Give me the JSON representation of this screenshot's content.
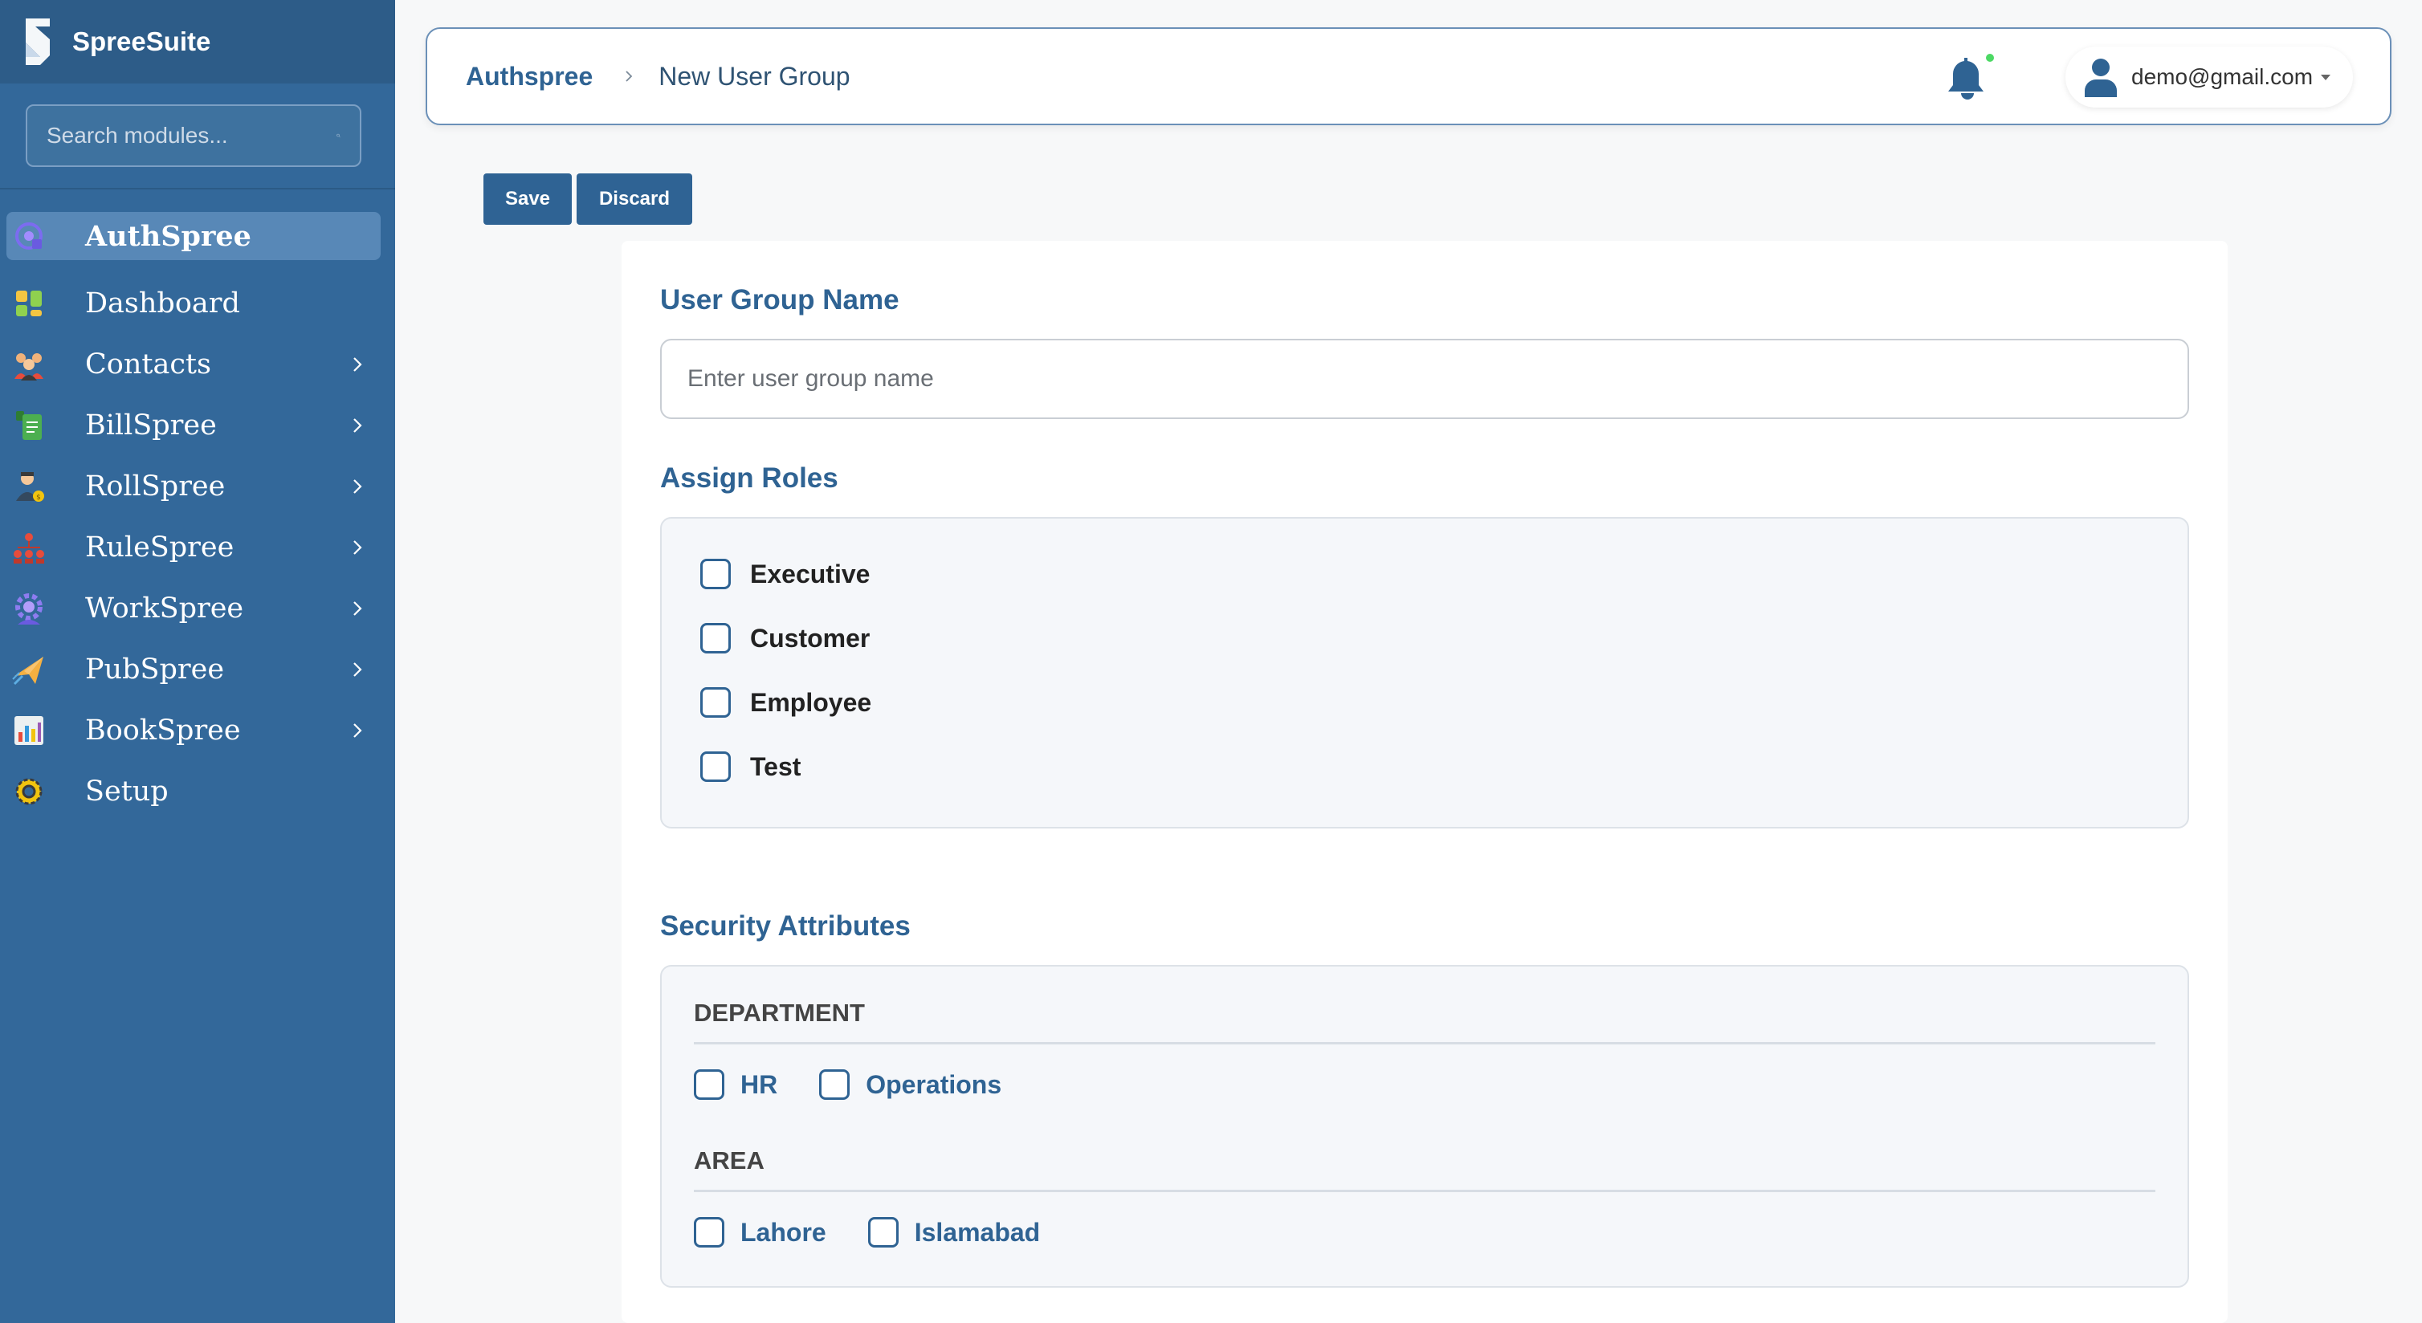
{
  "app": {
    "name": "SpreeSuite"
  },
  "search": {
    "placeholder": "Search modules..."
  },
  "sidebar": {
    "items": [
      {
        "label": "AuthSpree",
        "active": true,
        "has_children": false,
        "icon": "authspree-icon"
      },
      {
        "label": "Dashboard",
        "active": false,
        "has_children": false,
        "icon": "dashboard-icon"
      },
      {
        "label": "Contacts",
        "active": false,
        "has_children": true,
        "icon": "contacts-icon"
      },
      {
        "label": "BillSpree",
        "active": false,
        "has_children": true,
        "icon": "billspree-icon"
      },
      {
        "label": "RollSpree",
        "active": false,
        "has_children": true,
        "icon": "rollspree-icon"
      },
      {
        "label": "RuleSpree",
        "active": false,
        "has_children": true,
        "icon": "rulespree-icon"
      },
      {
        "label": "WorkSpree",
        "active": false,
        "has_children": true,
        "icon": "workspree-icon"
      },
      {
        "label": "PubSpree",
        "active": false,
        "has_children": true,
        "icon": "pubspree-icon"
      },
      {
        "label": "BookSpree",
        "active": false,
        "has_children": true,
        "icon": "bookspree-icon"
      },
      {
        "label": "Setup",
        "active": false,
        "has_children": false,
        "icon": "setup-gear-icon"
      }
    ]
  },
  "header": {
    "breadcrumb_root": "Authspree",
    "breadcrumb_current": "New User Group",
    "notification_dot_color": "#4cd964",
    "user_email": "demo@gmail.com"
  },
  "toolbar": {
    "save_label": "Save",
    "discard_label": "Discard"
  },
  "form": {
    "group_name_title": "User Group Name",
    "group_name_placeholder": "Enter user group name",
    "group_name_value": "",
    "roles_title": "Assign Roles",
    "roles": [
      {
        "label": "Executive",
        "checked": false
      },
      {
        "label": "Customer",
        "checked": false
      },
      {
        "label": "Employee",
        "checked": false
      },
      {
        "label": "Test",
        "checked": false
      }
    ],
    "security_title": "Security Attributes",
    "attributes": [
      {
        "heading": "DEPARTMENT",
        "options": [
          {
            "label": "HR",
            "checked": false
          },
          {
            "label": "Operations",
            "checked": false
          }
        ]
      },
      {
        "heading": "AREA",
        "options": [
          {
            "label": "Lahore",
            "checked": false
          },
          {
            "label": "Islamabad",
            "checked": false
          }
        ]
      }
    ]
  },
  "colors": {
    "sidebar_bg": "#33689a",
    "brand_bg": "#2d5c88",
    "accent": "#2f6393",
    "active_item_bg": "#5888b7"
  }
}
